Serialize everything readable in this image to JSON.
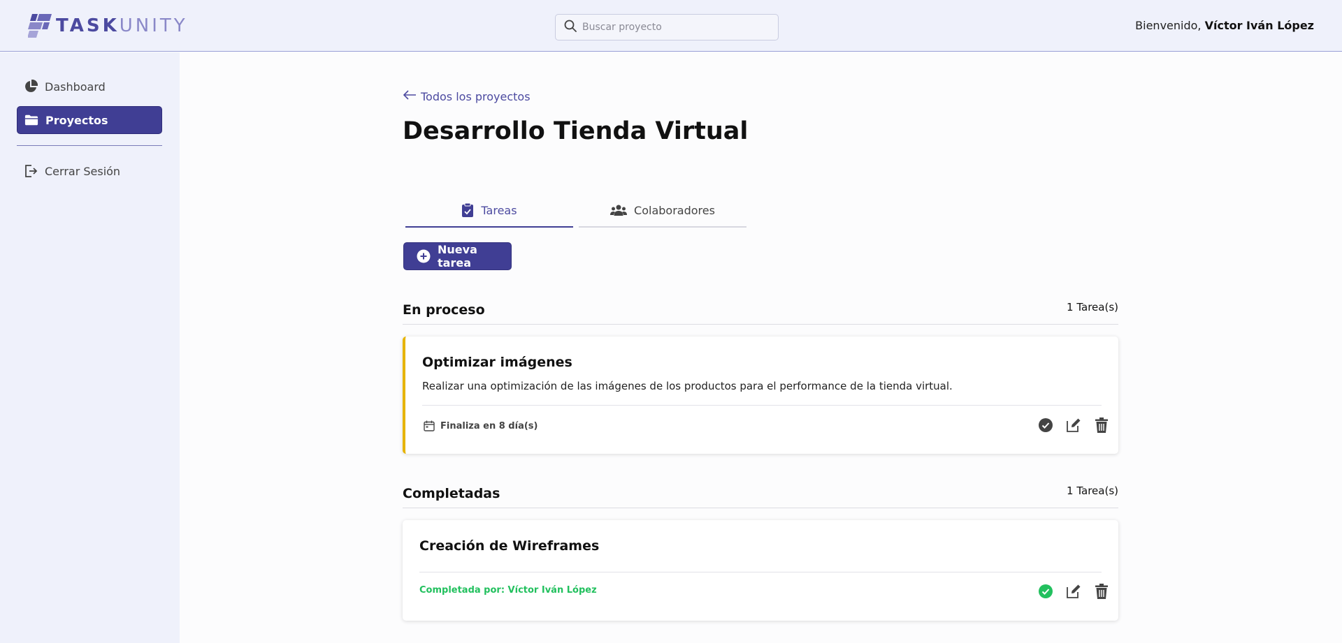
{
  "header": {
    "logo_text_a": "TASK",
    "logo_text_b": "UNITY",
    "search_placeholder": "Buscar proyecto",
    "welcome_prefix": "Bienvenido,",
    "user_name": "Víctor Iván López"
  },
  "sidebar": {
    "items": [
      {
        "label": "Dashboard",
        "icon": "pie-chart-icon"
      },
      {
        "label": "Proyectos",
        "icon": "folder-icon",
        "active": true
      },
      {
        "label": "Cerrar Sesión",
        "icon": "logout-icon"
      }
    ]
  },
  "main": {
    "back_label": "Todos los proyectos",
    "title": "Desarrollo Tienda Virtual",
    "tabs": [
      {
        "label": "Tareas",
        "icon": "clipboard-check-icon",
        "active": true
      },
      {
        "label": "Colaboradores",
        "icon": "users-icon"
      }
    ],
    "new_task_label": "Nueva tarea",
    "sections": [
      {
        "title": "En proceso",
        "count": "1 Tarea(s)",
        "tasks": [
          {
            "title": "Optimizar imágenes",
            "description": "Realizar una optimización de las imágenes de los productos para el performance de la tienda virtual.",
            "due": "Finaliza en 8 día(s)"
          }
        ]
      },
      {
        "title": "Completadas",
        "count": "1 Tarea(s)",
        "tasks": [
          {
            "title": "Creación de Wireframes",
            "completed_by": "Completada por: Víctor Iván López"
          }
        ]
      }
    ]
  },
  "colors": {
    "accent": "#403e94",
    "sidebar_bg": "#eff1fb",
    "in_progress_border": "#e6b400",
    "completed_green": "#22c05e"
  }
}
